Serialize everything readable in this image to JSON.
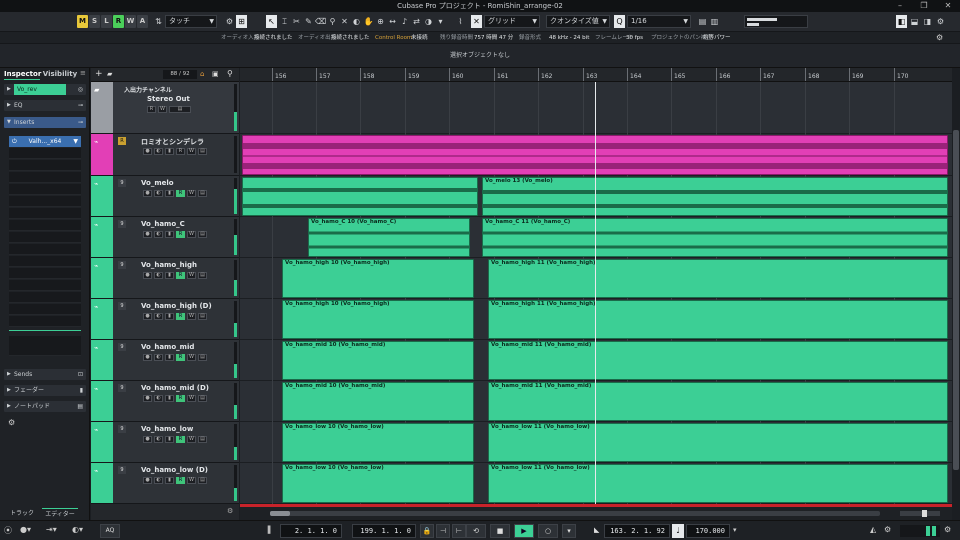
{
  "window": {
    "title": "Cubase Pro プロジェクト - RomiShin_arrange-02"
  },
  "toolbar": {
    "m": "M",
    "s": "S",
    "l": "L",
    "r": "R",
    "w": "W",
    "a": "A",
    "automation_mode": "タッチ",
    "snap_type": "グリッド",
    "quantize_type": "クオンタイズ値",
    "quantize_value": "1/16"
  },
  "info": {
    "audio_in_label": "オーディオ入力",
    "audio_in_value": "接続されました",
    "audio_out_label": "オーディオ出力",
    "audio_out_value": "接続されました",
    "control_room_label": "Control Room",
    "control_room_value": "未接続",
    "rec_time_label": "残り録音時間",
    "rec_time_value": "757 時間 47 分",
    "rec_format_label": "録音形式",
    "rec_format_value": "48 kHz - 24 bit",
    "frame_rate_label": "フレームレート",
    "frame_rate_value": "30 fps",
    "pan_label": "プロジェクトのパン補正",
    "power_label": "均等パワー"
  },
  "selection_line": "選択オブジェクトなし",
  "inspector": {
    "tab_inspector": "Inspector",
    "tab_visibility": "Visibility",
    "track_name": "Vo_rev",
    "eq_label": "EQ",
    "inserts_label": "Inserts",
    "insert_slot_1": "Valh..._x64",
    "sends_label": "Sends",
    "fader_label": "フェーダー",
    "notepad_label": "ノートパッド",
    "bottom_tab_track": "トラック",
    "bottom_tab_editor": "エディター"
  },
  "tracklist_header": {
    "counter": "88 / 92"
  },
  "tracks": [
    {
      "name": "入出力チャンネル",
      "sub": "Stereo Out"
    },
    {
      "name": "ロミオとシンデレラ"
    },
    {
      "name": "Vo_melo"
    },
    {
      "name": "Vo_hamo_C"
    },
    {
      "name": "Vo_hamo_high"
    },
    {
      "name": "Vo_hamo_high (D)"
    },
    {
      "name": "Vo_hamo_mid"
    },
    {
      "name": "Vo_hamo_mid (D)"
    },
    {
      "name": "Vo_hamo_low"
    },
    {
      "name": "Vo_hamo_low (D)"
    }
  ],
  "ruler": {
    "bars": [
      "156",
      "157",
      "158",
      "159",
      "160",
      "161",
      "162",
      "163",
      "164",
      "165",
      "166",
      "167",
      "168",
      "169",
      "170"
    ]
  },
  "events": {
    "melo_13": "Vo_melo 13 (Vo_melo)",
    "hamo_c_10": "Vo_hamo_C 10 (Vo_hamo_C)",
    "hamo_c_11": "Vo_hamo_C 11 (Vo_hamo_C)",
    "high_10": "Vo_hamo_high 10 (Vo_hamo_high)",
    "high_11": "Vo_hamo_high 11 (Vo_hamo_high)",
    "highd_10": "Vo_hamo_high 10 (Vo_hamo_high)",
    "highd_11": "Vo_hamo_high 11 (Vo_hamo_high)",
    "mid_10": "Vo_hamo_mid 10 (Vo_hamo_mid)",
    "mid_11": "Vo_hamo_mid 11 (Vo_hamo_mid)",
    "midd_10": "Vo_hamo_mid 10 (Vo_hamo_mid)",
    "midd_11": "Vo_hamo_mid 11 (Vo_hamo_mid)",
    "low_10": "Vo_hamo_low 10 (Vo_hamo_low)",
    "low_11": "Vo_hamo_low 11 (Vo_hamo_low)",
    "lowd_10": "Vo_hamo_low 10 (Vo_hamo_low)",
    "lowd_11": "Vo_hamo_low 11 (Vo_hamo_low)"
  },
  "transport": {
    "aq": "AQ",
    "left_locator": "2. 1. 1. 0",
    "right_locator": "199. 1. 1. 0",
    "position": "163. 2. 1. 92",
    "tempo": "170.000"
  },
  "colors": {
    "accent_green": "#3ccf95",
    "master_pink": "#e23fb6",
    "cursor": "#e6e9ec"
  }
}
